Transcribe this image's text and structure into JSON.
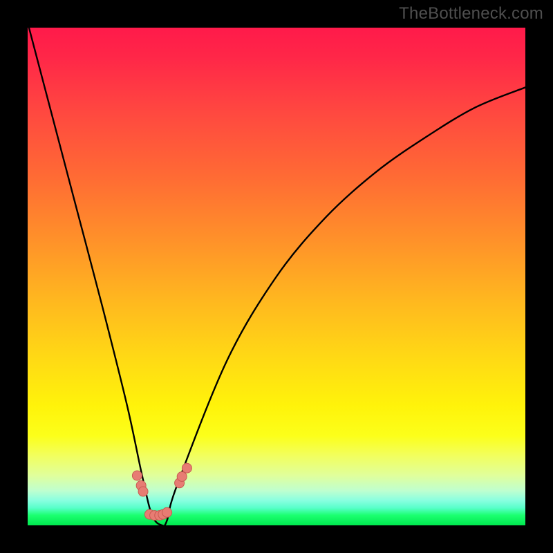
{
  "watermark": "TheBottleneck.com",
  "chart_data": {
    "type": "line",
    "title": "",
    "xlabel": "",
    "ylabel": "",
    "xlim": [
      0,
      100
    ],
    "ylim": [
      0,
      100
    ],
    "grid": false,
    "legend": false,
    "series": [
      {
        "name": "curve",
        "x": [
          0,
          5,
          10,
          15,
          20,
          23,
          25,
          27,
          28,
          30,
          40,
          50,
          60,
          70,
          80,
          90,
          100
        ],
        "y": [
          101,
          82,
          63,
          44,
          24,
          10,
          2,
          0,
          1,
          8,
          33,
          50,
          62,
          71,
          78,
          84,
          88
        ]
      }
    ],
    "markers": [
      {
        "x": 22.0,
        "y": 10.0
      },
      {
        "x": 22.8,
        "y": 8.0
      },
      {
        "x": 23.2,
        "y": 6.8
      },
      {
        "x": 24.5,
        "y": 2.2
      },
      {
        "x": 25.5,
        "y": 2.0
      },
      {
        "x": 26.5,
        "y": 2.0
      },
      {
        "x": 27.2,
        "y": 2.2
      },
      {
        "x": 28.0,
        "y": 2.6
      },
      {
        "x": 30.5,
        "y": 8.5
      },
      {
        "x": 31.0,
        "y": 9.8
      },
      {
        "x": 32.0,
        "y": 11.5
      }
    ],
    "marker_style": {
      "fill": "#e77c73",
      "stroke": "#c85b52",
      "r": 7
    },
    "curve_style": {
      "stroke": "#000000",
      "width": 2.4
    },
    "gradient_stops": [
      {
        "pct": 0,
        "color": "#ff1a4a"
      },
      {
        "pct": 17,
        "color": "#ff4840"
      },
      {
        "pct": 42,
        "color": "#ff8f2a"
      },
      {
        "pct": 67,
        "color": "#ffdb14"
      },
      {
        "pct": 86,
        "color": "#f2ff5e"
      },
      {
        "pct": 96.5,
        "color": "#58ffca"
      },
      {
        "pct": 100,
        "color": "#00e84f"
      }
    ]
  }
}
